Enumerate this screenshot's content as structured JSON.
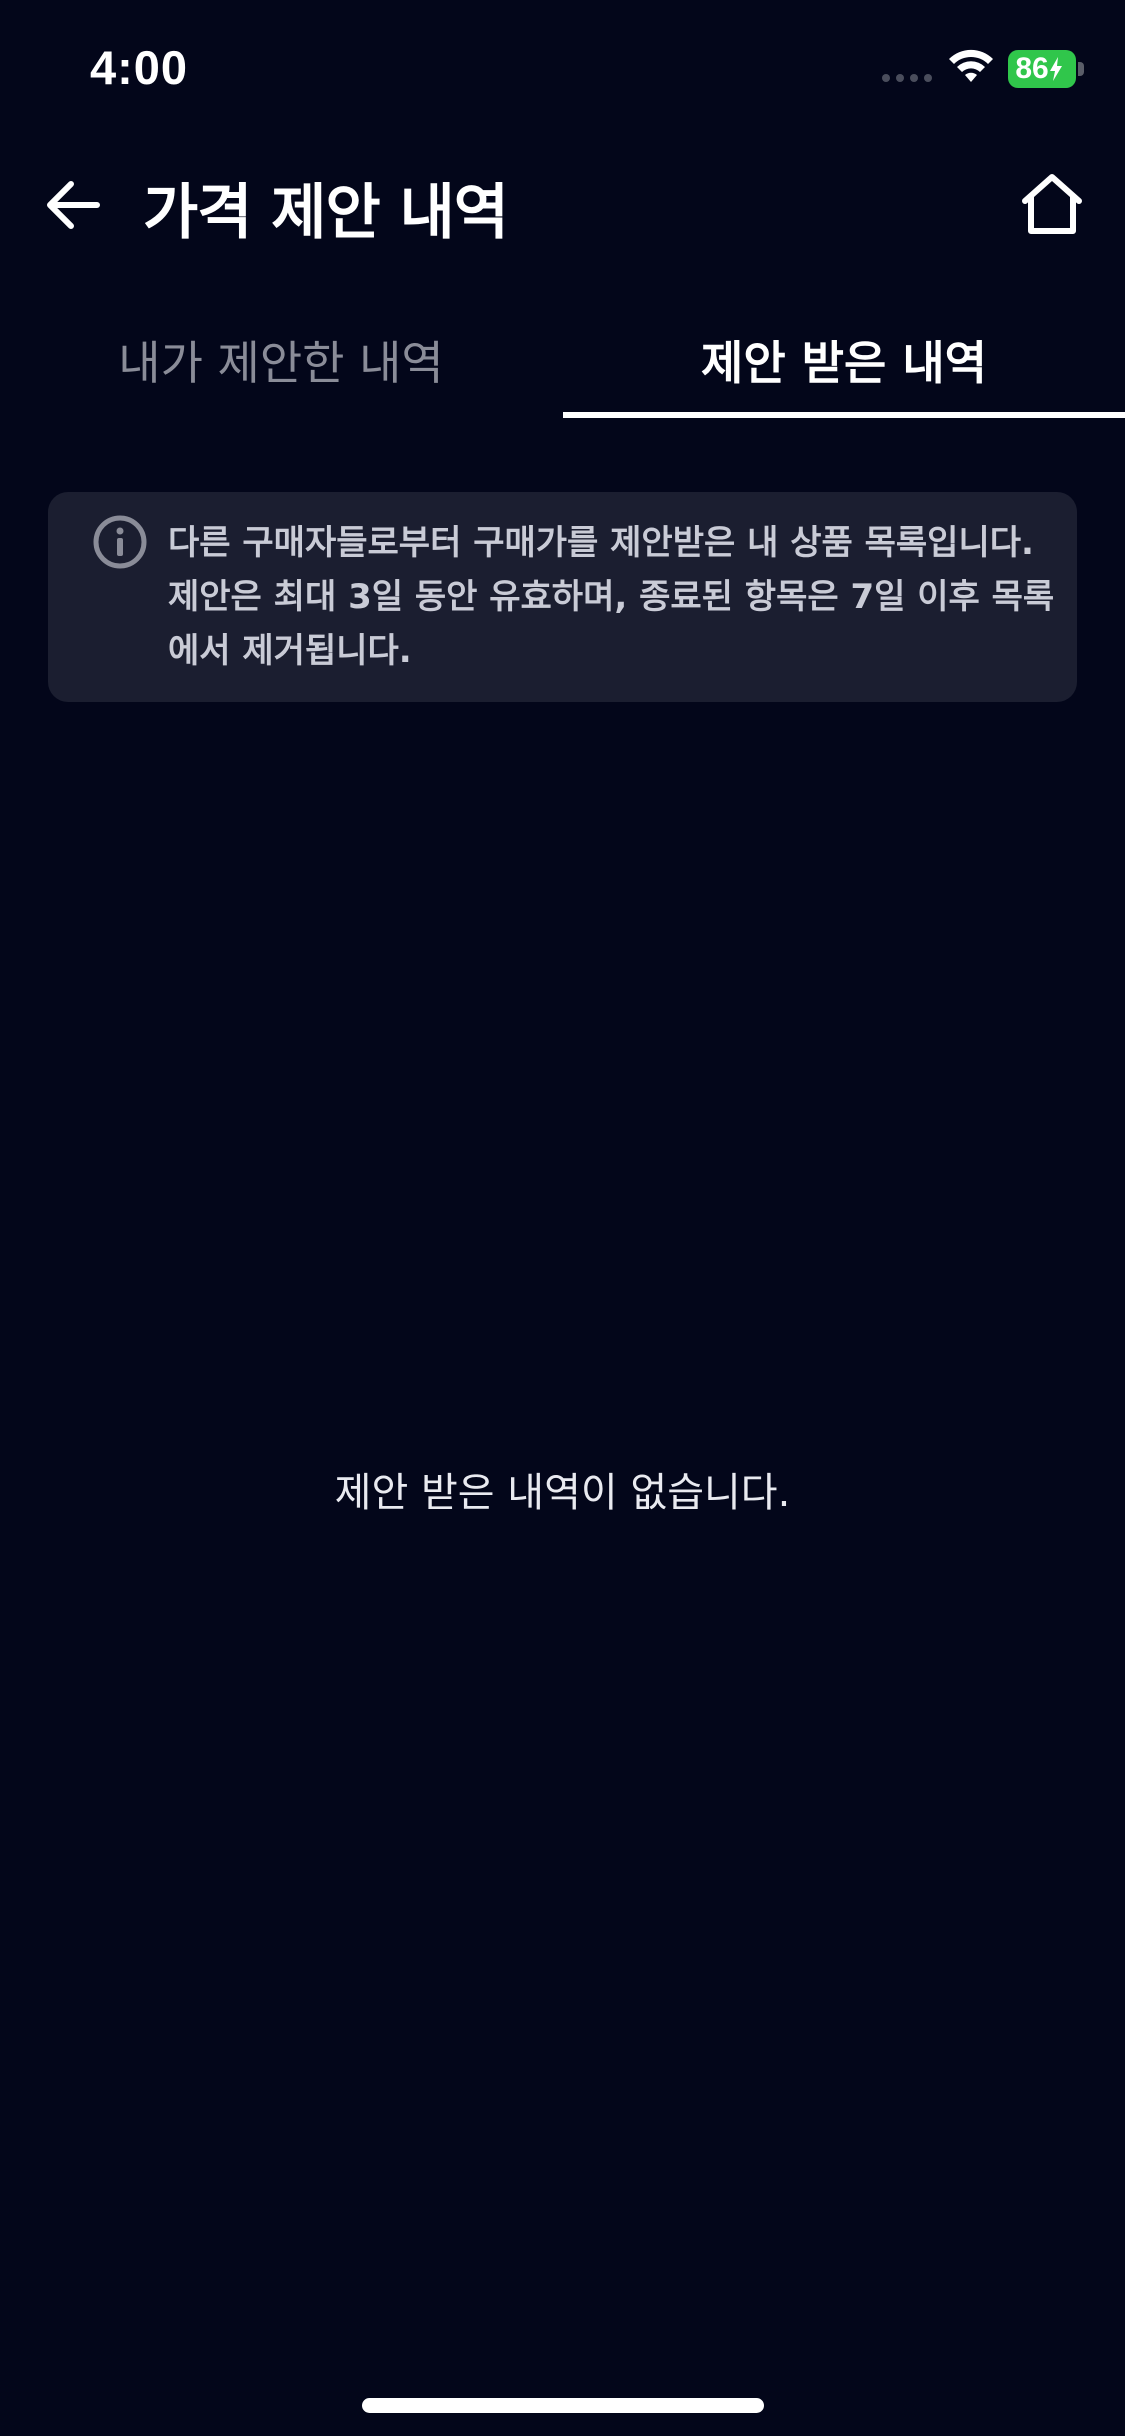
{
  "status_bar": {
    "time": "4:00",
    "battery_level": "86",
    "icons": [
      "signal-icon",
      "wifi-icon",
      "battery-charging-icon"
    ]
  },
  "header": {
    "title": "가격 제안 내역",
    "back_icon": "arrow-left-icon",
    "home_icon": "home-icon"
  },
  "tabs": [
    {
      "label": "내가 제안한 내역",
      "selected": false
    },
    {
      "label": "제안 받은 내역",
      "selected": true
    }
  ],
  "info": {
    "icon": "info-icon",
    "lines": [
      "다른 구매자들로부터 구매가를 제안받은 내 상품 목록입니다.",
      "제안은 최대 3일 동안 유효하며, 종료된 항목은 7일 이후 목록",
      "에서 제거됩니다."
    ]
  },
  "empty_state": {
    "message": "제안 받은 내역이 없습니다."
  },
  "colors": {
    "background": "#03061a",
    "info_box": "#1b1e30",
    "battery": "#30c64b",
    "tab_inactive": "#8a8c98"
  }
}
